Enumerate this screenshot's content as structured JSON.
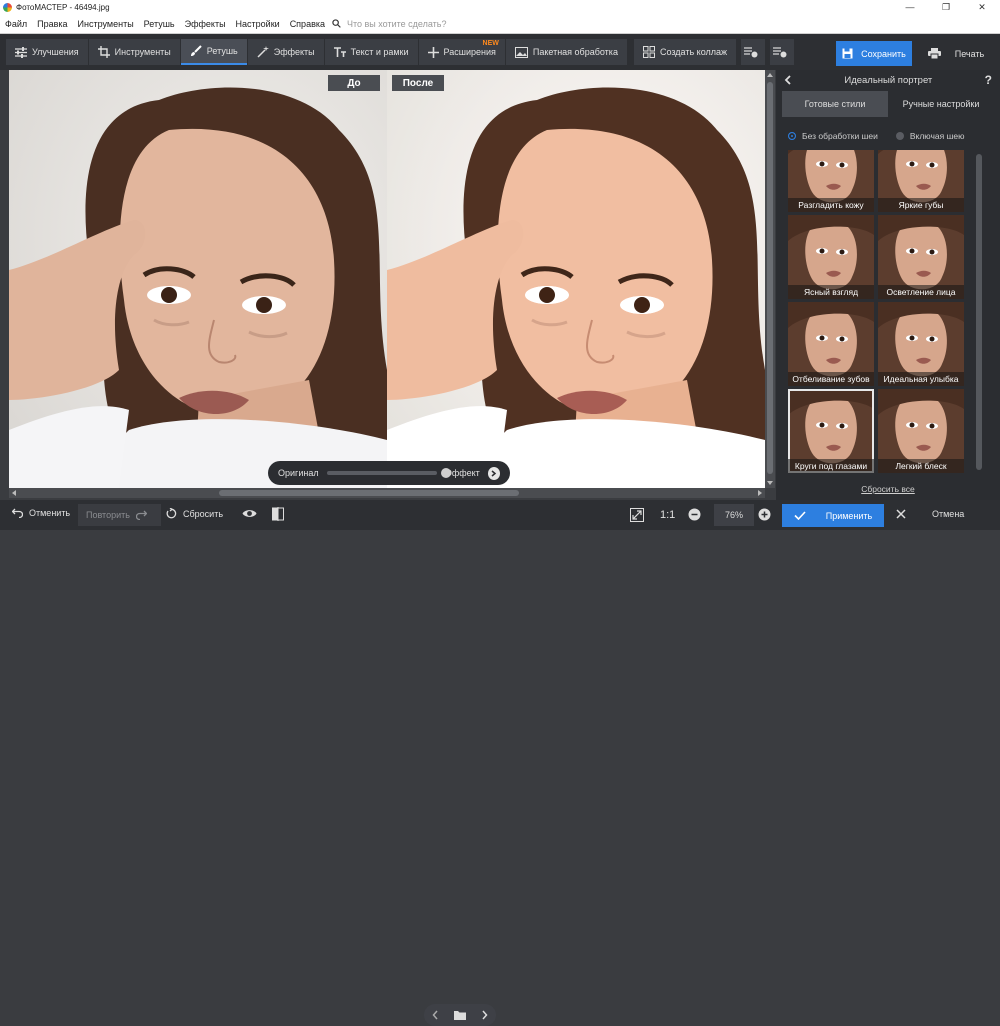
{
  "window": {
    "title": "ФотоМАСТЕР - 46494.jpg"
  },
  "menu": {
    "items": [
      "Файл",
      "Правка",
      "Инструменты",
      "Ретушь",
      "Эффекты",
      "Настройки",
      "Справка"
    ],
    "search_placeholder": "Что вы хотите сделать?"
  },
  "toolbar": {
    "tabs": [
      {
        "label": "Улучшения",
        "icon": "sliders-icon"
      },
      {
        "label": "Инструменты",
        "icon": "crop-icon"
      },
      {
        "label": "Ретушь",
        "icon": "brush-icon",
        "active": true
      },
      {
        "label": "Эффекты",
        "icon": "wand-icon"
      },
      {
        "label": "Текст и рамки",
        "icon": "text-icon"
      },
      {
        "label": "Расширения",
        "icon": "plus-icon",
        "badge": "NEW"
      },
      {
        "label": "Пакетная обработка",
        "icon": "images-icon"
      },
      {
        "label": "Создать коллаж",
        "icon": "collage-icon"
      }
    ],
    "save_label": "Сохранить",
    "print_label": "Печать"
  },
  "canvas": {
    "before_label": "До",
    "after_label": "После",
    "slider_left": "Оригинал",
    "slider_right": "Эффект",
    "slider_value": 1.0
  },
  "panel": {
    "title": "Идеальный портрет",
    "help": "?",
    "tab_presets": "Готовые стили",
    "tab_manual": "Ручные настройки",
    "radio_no_neck": "Без обработки шеи",
    "radio_with_neck": "Включая шею",
    "presets": [
      "Разгладить кожу",
      "Яркие губы",
      "Ясный взгляд",
      "Осветление лица",
      "Отбеливание зубов",
      "Идеальная улыбка",
      "Круги под глазами",
      "Легкий блеск"
    ],
    "selected_preset": "Круги под глазами",
    "reset_all": "Сбросить все"
  },
  "bottombar": {
    "undo": "Отменить",
    "redo": "Повторить",
    "reset": "Сбросить",
    "zoom_fit": "1:1",
    "zoom_value": "76%",
    "apply": "Применить",
    "cancel": "Отмена"
  },
  "colors": {
    "accent": "#2d7fe0",
    "badge_new": "#ff8a1e"
  }
}
